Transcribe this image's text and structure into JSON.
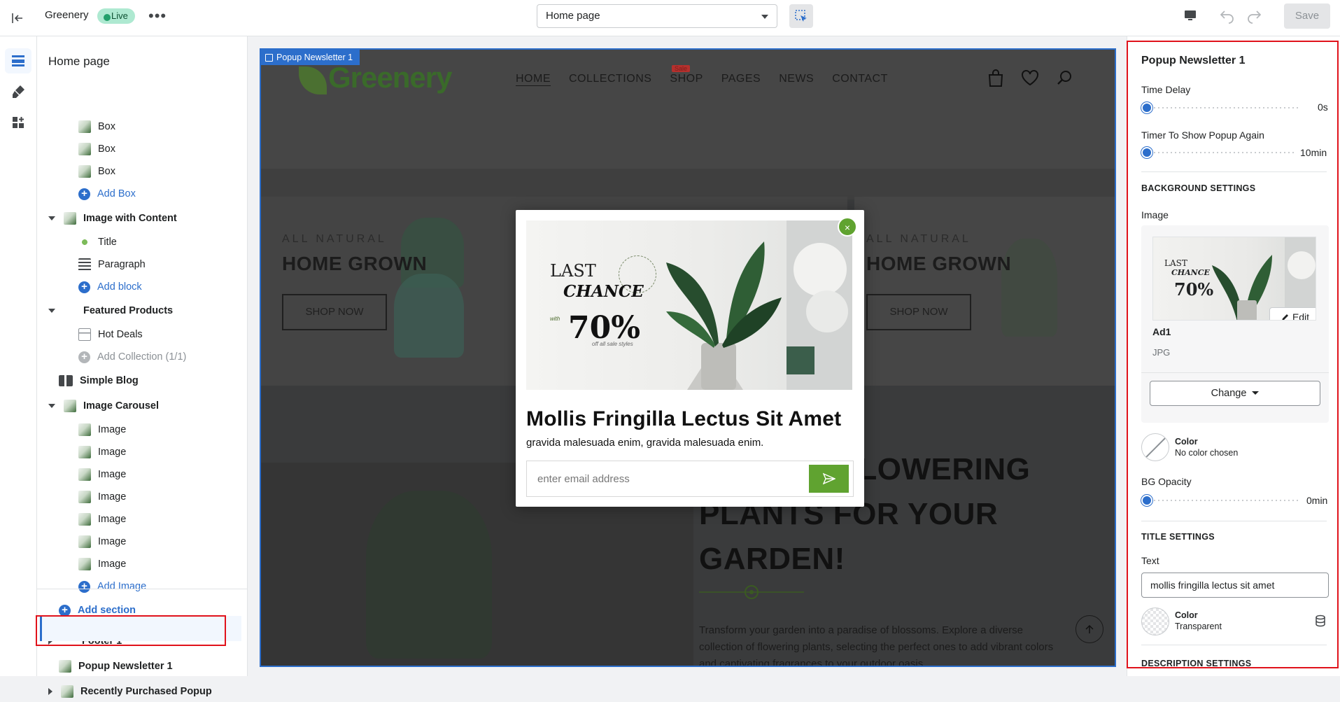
{
  "topbar": {
    "store_name": "Greenery",
    "status_badge": "Live",
    "more_label": "•••",
    "page_select": "Home page",
    "save_label": "Save"
  },
  "sidebar": {
    "title": "Home page",
    "items": [
      {
        "label": "Box"
      },
      {
        "label": "Box"
      },
      {
        "label": "Box"
      },
      {
        "label": "Add Box"
      },
      {
        "label": "Image with Content"
      },
      {
        "label": "Title"
      },
      {
        "label": "Paragraph"
      },
      {
        "label": "Add block"
      },
      {
        "label": "Featured Products"
      },
      {
        "label": "Hot Deals"
      },
      {
        "label": "Add Collection (1/1)"
      },
      {
        "label": "Simple Blog"
      },
      {
        "label": "Image Carousel"
      },
      {
        "label": "Image"
      },
      {
        "label": "Image"
      },
      {
        "label": "Image"
      },
      {
        "label": "Image"
      },
      {
        "label": "Image"
      },
      {
        "label": "Image"
      },
      {
        "label": "Image"
      },
      {
        "label": "Add Image"
      },
      {
        "label": "Add section"
      },
      {
        "label": "Footer 1"
      },
      {
        "label": "Popup Newsletter 1"
      },
      {
        "label": "Recently Purchased Popup"
      }
    ]
  },
  "preview": {
    "section_tag": "Popup Newsletter 1",
    "logo": "Greenery",
    "nav": [
      "HOME",
      "COLLECTIONS",
      "SHOP",
      "PAGES",
      "NEWS",
      "CONTACT"
    ],
    "sale_badge": "Sale",
    "hero_left": {
      "eyebrow": "ALL NATURAL",
      "title": "HOME GROWN",
      "button": "SHOP NOW"
    },
    "hero_right": {
      "eyebrow": "ALL NATURAL",
      "title": "HOME GROWN",
      "button": "SHOP NOW"
    },
    "lower_title": "...RFECT FLOWERING PLANTS FOR YOUR GARDEN!",
    "lower_text": "Transform your garden into a paradise of blossoms. Explore a diverse collection of flowering plants, selecting the perfect ones to add vibrant colors and captivating fragrances to your outdoor oasis."
  },
  "popup": {
    "image_text": {
      "last": "LAST",
      "chance": "CHANCE",
      "with": "with",
      "percent": "70%",
      "off": "off all sale styles"
    },
    "close_label": "×",
    "title": "Mollis Fringilla Lectus Sit Amet",
    "description": "gravida malesuada enim, gravida malesuada enim.",
    "email_placeholder": "enter email address"
  },
  "panel": {
    "title": "Popup Newsletter 1",
    "time_delay": {
      "label": "Time Delay",
      "value": "0s",
      "fraction": 0
    },
    "timer_again": {
      "label": "Timer To Show Popup Again",
      "value": "10min",
      "fraction": 0
    },
    "bg_heading": "BACKGROUND SETTINGS",
    "image_label": "Image",
    "image_thumb_text": {
      "last": "LAST",
      "chance": "CHANCE",
      "percent": "70%"
    },
    "edit_label": "Edit",
    "image_name": "Ad1",
    "image_type": "JPG",
    "change_label": "Change",
    "bg_color": {
      "label": "Color",
      "value": "No color chosen"
    },
    "bg_opacity": {
      "label": "BG Opacity",
      "value": "0min",
      "fraction": 0
    },
    "title_heading": "TITLE SETTINGS",
    "text_label": "Text",
    "text_value": "mollis fringilla lectus sit amet",
    "title_color": {
      "label": "Color",
      "value": "Transparent"
    },
    "desc_heading": "DESCRIPTION SETTINGS"
  },
  "colors": {
    "accent": "#2c6ecb",
    "highlight": "#e0121b",
    "brand_green": "#60a330",
    "live_badge": "#aee9d1"
  }
}
